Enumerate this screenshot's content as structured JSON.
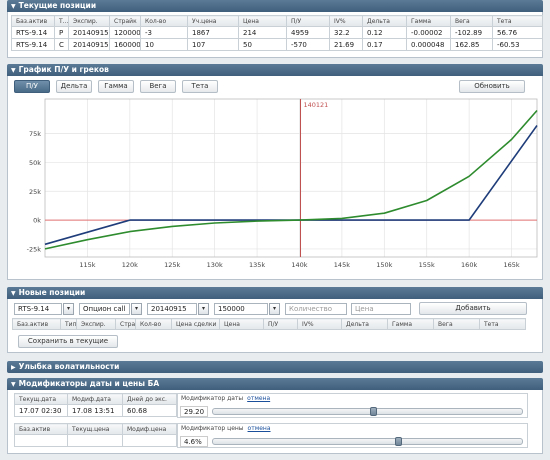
{
  "positions": {
    "title": "Текущие позиции",
    "headers": [
      "Баз.актив",
      "Т...",
      "Экспир.",
      "Страйк",
      "Кол-во",
      "Уч.цена",
      "Цена",
      "П/У",
      "IV%",
      "Дельта",
      "Гамма",
      "Вега",
      "Тета"
    ],
    "rows": [
      [
        "RTS-9.14",
        "P",
        "20140915",
        "120000",
        "-3",
        "1867",
        "214",
        "4959",
        "32.2",
        "0.12",
        "-0.00002",
        "-102.89",
        "56.76"
      ],
      [
        "RTS-9.14",
        "C",
        "20140915",
        "160000",
        "10",
        "107",
        "50",
        "-570",
        "21.69",
        "0.17",
        "0.000048",
        "162.85",
        "-60.53"
      ]
    ]
  },
  "chart_panel": {
    "title": "График П/У и греков",
    "tabs": [
      "П/У",
      "Дельта",
      "Гамма",
      "Вега",
      "Тета"
    ],
    "active_tab": "П/У",
    "refresh_label": "Обновить"
  },
  "chart_data": {
    "type": "line",
    "title": "",
    "xlabel": "",
    "ylabel": "",
    "xlim": [
      110000,
      168000
    ],
    "ylim": [
      -32000,
      105000
    ],
    "x_ticks": [
      115000,
      120000,
      125000,
      130000,
      135000,
      140000,
      145000,
      150000,
      155000,
      160000,
      165000
    ],
    "x_tick_labels": [
      "115k",
      "120k",
      "125k",
      "130k",
      "135k",
      "140k",
      "145k",
      "150k",
      "155k",
      "160k",
      "165k"
    ],
    "y_ticks": [
      -25000,
      0,
      25000,
      50000,
      75000
    ],
    "y_tick_labels": [
      "-25k",
      "0k",
      "25k",
      "50k",
      "75k"
    ],
    "grid": true,
    "marker_x": 140121,
    "marker_label": "140121",
    "series": [
      {
        "color": "#1f3d7a",
        "x": [
          110000,
          120000,
          160000,
          168000
        ],
        "y": [
          -21000,
          0,
          0,
          82000
        ]
      },
      {
        "color": "#2e8b2e",
        "x": [
          110000,
          115000,
          120000,
          125000,
          130000,
          135000,
          140000,
          145000,
          150000,
          155000,
          160000,
          165000,
          168000
        ],
        "y": [
          -25000,
          -17000,
          -10000,
          -5500,
          -2500,
          -900,
          0,
          1500,
          6000,
          17000,
          38000,
          70000,
          95000
        ]
      }
    ],
    "colors": {
      "zero_line": "#e07070",
      "marker_line": "#c05050",
      "grid": "#e4e4e4"
    }
  },
  "new_positions": {
    "title": "Новые позиции",
    "asset_value": "RTS-9.14",
    "type_value": "Опцион call",
    "expiry_value": "20140915",
    "strike_value": "150000",
    "quantity_placeholder": "Количество",
    "price_placeholder": "Цена",
    "add_label": "Добавить",
    "headers": [
      "Баз.актив",
      "Тип",
      "Экспир.",
      "Страйк",
      "Кол-во",
      "Цена сделки",
      "Цена",
      "П/У",
      "IV%",
      "Дельта",
      "Гамма",
      "Вега",
      "Тета"
    ],
    "save_label": "Сохранить в текущие"
  },
  "smile": {
    "title": "Улыбка волатильности"
  },
  "modifiers": {
    "title": "Модификаторы даты и цены БА",
    "row1_headers": [
      "Текущ.дата",
      "Модиф.дата",
      "Дней до экс."
    ],
    "row1_values": [
      "17.07 02:30",
      "17.08 13:51",
      "60.68"
    ],
    "date_mod_label": "Модификатор даты",
    "date_mod_value": "29.20",
    "date_slider_level": 0.52,
    "row2_headers": [
      "Баз.актив",
      "Текущ.цена",
      "Модиф.цена"
    ],
    "row2_values": [
      "",
      "",
      ""
    ],
    "price_mod_label": "Модификатор цены",
    "price_mod_value": "4.6%",
    "price_slider_level": 0.6,
    "cancel_label": "отмена",
    "icons": {
      "collapse": "triangle-down-icon",
      "expand": "triangle-right-icon",
      "dropdown": "chevron-down-icon"
    }
  }
}
